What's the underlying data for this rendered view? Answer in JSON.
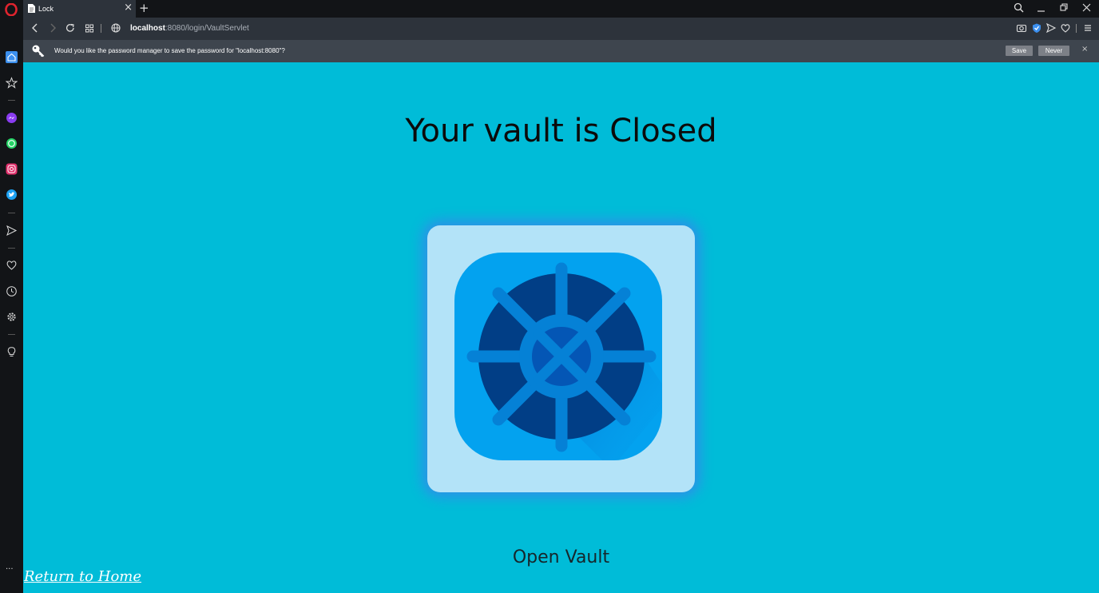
{
  "browser": {
    "tab": {
      "title": "Lock"
    },
    "address": {
      "host": "localhost",
      "rest": ":8080/login/VaultServlet"
    },
    "password_bar": {
      "message": "Would you like the password manager to save the password for \"localhost:8080\"?",
      "save_label": "Save",
      "never_label": "Never",
      "close_label": "×"
    },
    "sidebar_more": "···"
  },
  "page": {
    "heading": "Your vault is Closed",
    "open_vault_label": "Open Vault",
    "return_home_label": "Return to Home"
  },
  "colors": {
    "background": "#00bcd8",
    "card": "#b3e3f8",
    "card_glow": "#2f8fe8",
    "safe_outer": "#03a2ef",
    "safe_door": "#013e86",
    "safe_spokes": "#0581d6"
  },
  "icons": [
    "opera-logo-icon",
    "document-icon",
    "close-icon",
    "plus-icon",
    "search-icon",
    "minimize-icon",
    "restore-icon",
    "back-icon",
    "forward-icon",
    "reload-icon",
    "grid-icon",
    "globe-icon",
    "camera-icon",
    "shield-icon",
    "send-icon",
    "heart-icon",
    "menu-icon",
    "key-icon",
    "home-icon",
    "star-icon",
    "messenger-icon",
    "whatsapp-icon",
    "instagram-icon",
    "twitter-icon",
    "history-icon",
    "settings-icon",
    "lightbulb-icon",
    "vault-wheel-icon"
  ]
}
